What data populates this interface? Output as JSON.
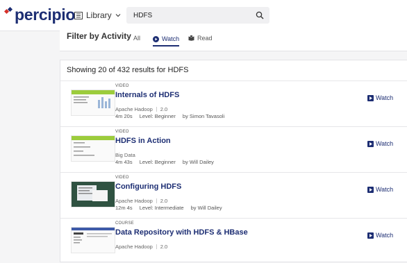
{
  "header": {
    "logo_text": "percipio",
    "library_label": "Library",
    "search_value": "HDFS"
  },
  "filter": {
    "title": "Filter by Activity",
    "tabs": [
      {
        "label": "All",
        "active": false
      },
      {
        "label": "Watch",
        "active": true
      },
      {
        "label": "Read",
        "active": false
      }
    ]
  },
  "results": {
    "summary": "Showing 20 of 432 results for HDFS",
    "items": [
      {
        "type": "VIDEO",
        "title": "Internals of HDFS",
        "category": "Apache Hadoop",
        "version": "2.0",
        "duration": "4m 20s",
        "level": "Level: Beginner",
        "author": "by Simon Tavasoli",
        "action": "Watch"
      },
      {
        "type": "VIDEO",
        "title": "HDFS in Action",
        "category": "Big Data",
        "version": "",
        "duration": "4m 43s",
        "level": "Level: Beginner",
        "author": "by Will Dailey",
        "action": "Watch"
      },
      {
        "type": "VIDEO",
        "title": "Configuring HDFS",
        "category": "Apache Hadoop",
        "version": "2.0",
        "duration": "12m 4s",
        "level": "Level: Intermediate",
        "author": "by Will Dailey",
        "action": "Watch"
      },
      {
        "type": "COURSE",
        "title": "Data Repository with HDFS & HBase",
        "category": "Apache Hadoop",
        "version": "2.0",
        "duration": "",
        "level": "",
        "author": "",
        "action": "Watch"
      }
    ]
  },
  "colors": {
    "brand": "#1d2e73",
    "accent_red": "#d6312b",
    "thumb_green": "#9ccc3c"
  }
}
